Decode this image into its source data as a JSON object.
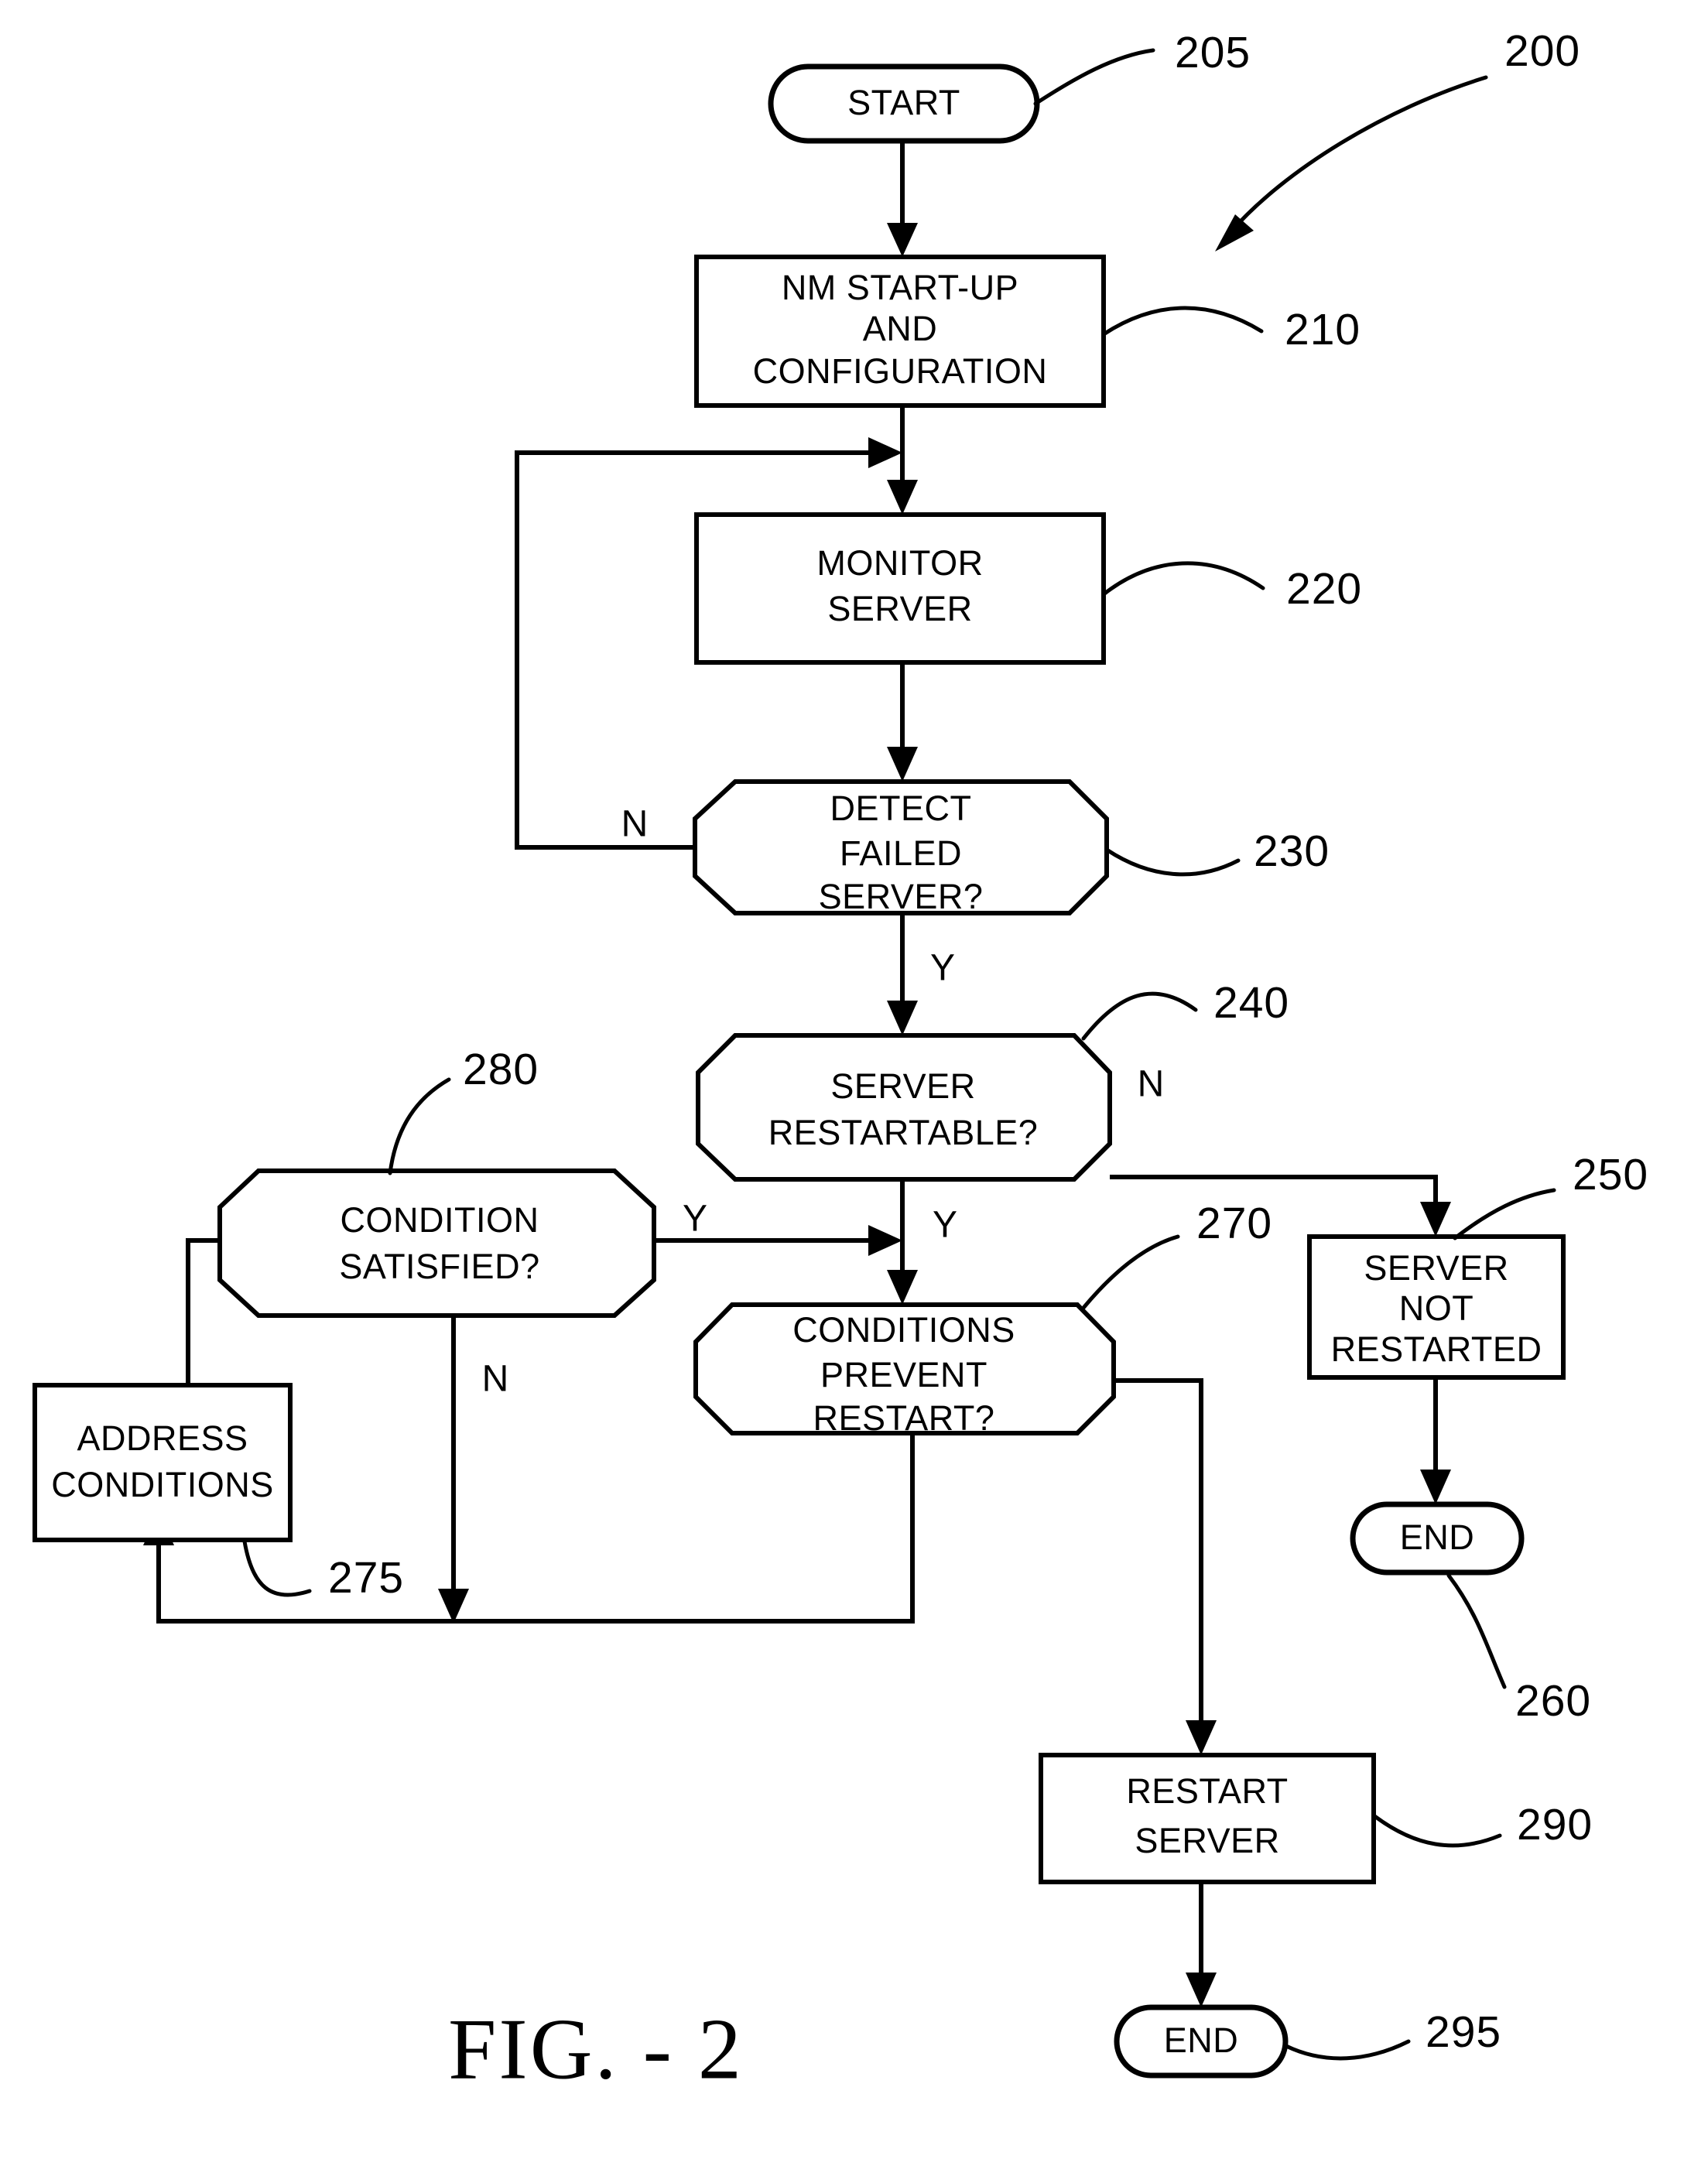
{
  "figure": {
    "caption": "FIG. - 2",
    "overall_ref": "200"
  },
  "nodes": {
    "start": {
      "label": "START",
      "ref": "205",
      "shape": "terminator"
    },
    "startup": {
      "line1": "NM START-UP",
      "line2": "AND",
      "line3": "CONFIGURATION",
      "ref": "210",
      "shape": "process"
    },
    "monitor": {
      "line1": "MONITOR",
      "line2": "SERVER",
      "ref": "220",
      "shape": "process"
    },
    "detect": {
      "line1": "DETECT",
      "line2": "FAILED",
      "line3": "SERVER?",
      "ref": "230",
      "shape": "decision"
    },
    "restartable": {
      "line1": "SERVER",
      "line2": "RESTARTABLE?",
      "ref": "240",
      "shape": "decision"
    },
    "not_restarted": {
      "line1": "SERVER",
      "line2": "NOT",
      "line3": "RESTARTED",
      "ref": "250",
      "shape": "process"
    },
    "end_right": {
      "label": "END",
      "ref": "260",
      "shape": "terminator"
    },
    "conditions_prevent": {
      "line1": "CONDITIONS",
      "line2": "PREVENT",
      "line3": "RESTART?",
      "ref": "270",
      "shape": "decision"
    },
    "address_conditions": {
      "line1": "ADDRESS",
      "line2": "CONDITIONS",
      "ref": "275",
      "shape": "process"
    },
    "condition_satisfied": {
      "line1": "CONDITION",
      "line2": "SATISFIED?",
      "ref": "280",
      "shape": "decision"
    },
    "restart_server": {
      "line1": "RESTART",
      "line2": "SERVER",
      "ref": "290",
      "shape": "process"
    },
    "end_bottom": {
      "label": "END",
      "ref": "295",
      "shape": "terminator"
    }
  },
  "branches": {
    "detect_no": "N",
    "detect_yes": "Y",
    "restartable_no": "N",
    "restartable_yes": "Y",
    "condition_satisfied_yes": "Y",
    "condition_satisfied_no": "N"
  }
}
